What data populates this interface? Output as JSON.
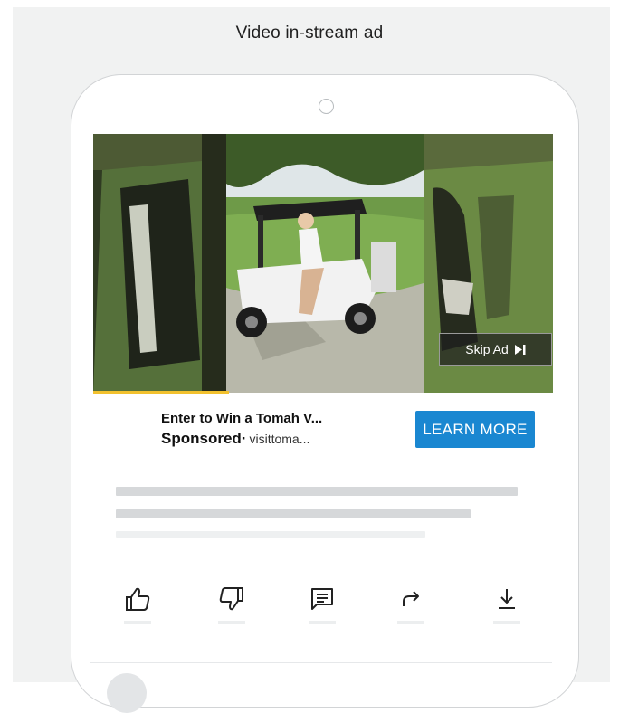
{
  "heading": "Video in-stream ad",
  "ad": {
    "title": "Enter to Win a Tomah V...",
    "sponsored": "Sponsored",
    "separator": "·",
    "domain": "visittoma...",
    "cta_label": "LEARN MORE",
    "skip_label": "Skip Ad"
  },
  "actions": [
    {
      "icon": "like-icon"
    },
    {
      "icon": "dislike-icon"
    },
    {
      "icon": "comment-icon"
    },
    {
      "icon": "share-icon"
    },
    {
      "icon": "download-icon"
    }
  ],
  "colors": {
    "cta": "#1a87d1",
    "progress": "#f2c12e",
    "background": "#f1f2f2"
  }
}
